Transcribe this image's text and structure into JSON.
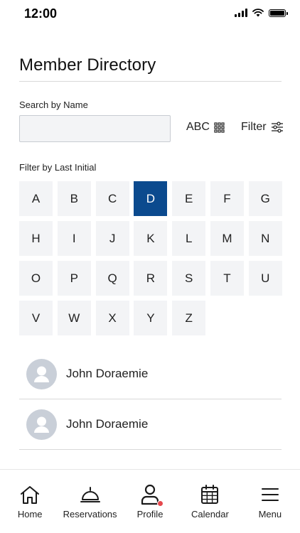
{
  "status_bar": {
    "time": "12:00"
  },
  "header": {
    "title": "Member Directory"
  },
  "search": {
    "label": "Search by Name",
    "value": "",
    "placeholder": "",
    "abc_label": "ABC",
    "filter_label": "Filter"
  },
  "initials": {
    "label": "Filter by Last Initial",
    "selected": "D",
    "letters": [
      "A",
      "B",
      "C",
      "D",
      "E",
      "F",
      "G",
      "H",
      "I",
      "J",
      "K",
      "L",
      "M",
      "N",
      "O",
      "P",
      "Q",
      "R",
      "S",
      "T",
      "U",
      "V",
      "W",
      "X",
      "Y",
      "Z"
    ]
  },
  "members": [
    {
      "name": "John Doraemie"
    },
    {
      "name": "John Doraemie"
    }
  ],
  "nav": {
    "items": [
      {
        "label": "Home",
        "icon": "home-icon"
      },
      {
        "label": "Reservations",
        "icon": "bell-icon"
      },
      {
        "label": "Profile",
        "icon": "profile-icon"
      },
      {
        "label": "Calendar",
        "icon": "calendar-icon"
      },
      {
        "label": "Menu",
        "icon": "menu-icon"
      }
    ]
  },
  "colors": {
    "accent": "#0b4a8e",
    "tile": "#f3f4f6",
    "badge": "#e5484d",
    "avatar": "#c9cfd8"
  }
}
